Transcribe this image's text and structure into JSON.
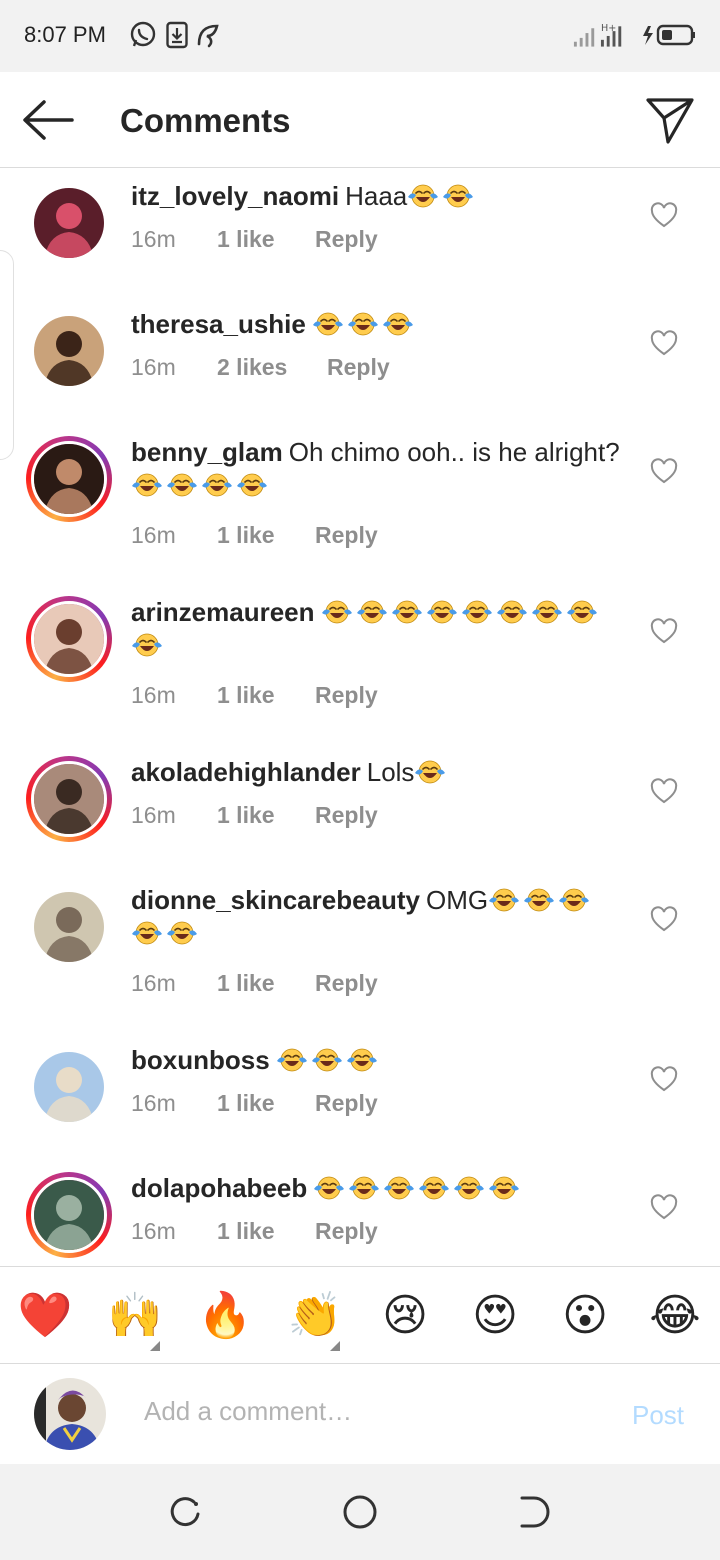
{
  "status_bar": {
    "time": "8:07 PM",
    "network_badge": "H+"
  },
  "header": {
    "title": "Comments"
  },
  "comments": [
    {
      "user": "itz_lovely_naomi",
      "text": "Haaa",
      "emoji_count": 2,
      "time": "16m",
      "likes": "1 like",
      "reply": "Reply",
      "story_ring": false,
      "avatar_colors": [
        "#5a1e2a",
        "#d9506a"
      ]
    },
    {
      "user": "theresa_ushie",
      "text": "",
      "emoji_count": 3,
      "time": "16m",
      "likes": "2 likes",
      "reply": "Reply",
      "story_ring": false,
      "avatar_colors": [
        "#c9a27a",
        "#3b2418"
      ]
    },
    {
      "user": "benny_glam",
      "text": "Oh chimo ooh.. is he alright?",
      "emoji_count": 4,
      "time": "16m",
      "likes": "1 like",
      "reply": "Reply",
      "story_ring": true,
      "avatar_colors": [
        "#2a1a14",
        "#c08a6a"
      ]
    },
    {
      "user": "arinzemaureen",
      "text": "",
      "emoji_count": 9,
      "time": "16m",
      "likes": "1 like",
      "reply": "Reply",
      "story_ring": true,
      "avatar_colors": [
        "#e8c9b8",
        "#6a3e2e"
      ]
    },
    {
      "user": "akoladehighlander",
      "text": "Lols",
      "emoji_count": 1,
      "time": "16m",
      "likes": "1 like",
      "reply": "Reply",
      "story_ring": true,
      "avatar_colors": [
        "#a98a7a",
        "#3a2a22"
      ]
    },
    {
      "user": "dionne_skincarebeauty",
      "text": "OMG",
      "emoji_count": 5,
      "time": "16m",
      "likes": "1 like",
      "reply": "Reply",
      "story_ring": false,
      "avatar_colors": [
        "#cfc6b0",
        "#7a6a5a"
      ]
    },
    {
      "user": "boxunboss",
      "text": "",
      "emoji_count": 3,
      "time": "16m",
      "likes": "1 like",
      "reply": "Reply",
      "story_ring": false,
      "avatar_colors": [
        "#a9c8e8",
        "#e8dcc8"
      ]
    },
    {
      "user": "dolapohabeeb",
      "text": "",
      "emoji_count": 6,
      "time": "16m",
      "likes": "1 like",
      "reply": "Reply",
      "story_ring": true,
      "avatar_colors": [
        "#3a5a4a",
        "#9ab0a0"
      ]
    }
  ],
  "reactions": [
    {
      "name": "heart",
      "glyph": "❤️"
    },
    {
      "name": "raising-hands",
      "glyph": "🙌"
    },
    {
      "name": "fire",
      "glyph": "🔥"
    },
    {
      "name": "clapping-hands",
      "glyph": "👏"
    },
    {
      "name": "crying-face",
      "glyph": "😢"
    },
    {
      "name": "heart-eyes",
      "glyph": "😍"
    },
    {
      "name": "surprised-face",
      "glyph": "😮"
    },
    {
      "name": "tears-of-joy",
      "glyph": "😂"
    }
  ],
  "compose": {
    "placeholder": "Add a comment…",
    "post_label": "Post"
  },
  "colors": {
    "accent_post": "#b3dbff",
    "muted_text": "#8e8e8e",
    "text": "#262626",
    "emoji_face": "#ffcc4d",
    "emoji_tear": "#4a9be8"
  },
  "icons": [
    "whatsapp-icon",
    "download-icon",
    "vpn-icon",
    "signal-icon",
    "battery-icon",
    "back-arrow-icon",
    "direct-message-icon",
    "heart-outline-icon",
    "recents-icon",
    "home-icon",
    "back-nav-icon"
  ]
}
